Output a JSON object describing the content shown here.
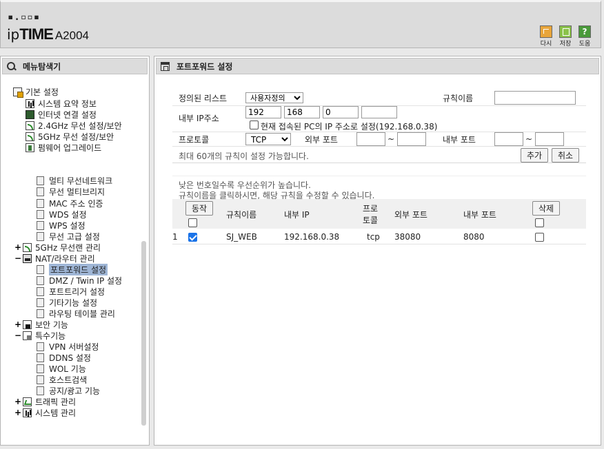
{
  "header": {
    "logo_dots": "▪.▫▫▪",
    "logo_brand_prefix": "ip",
    "logo_brand_main": "TIME",
    "model": "A2004",
    "buttons": [
      {
        "label": "다시",
        "icon": "reload-icon"
      },
      {
        "label": "저장",
        "icon": "save-icon"
      },
      {
        "label": "도움",
        "icon": "help-icon",
        "glyph": "?"
      }
    ]
  },
  "sidebar": {
    "title": "메뉴탐색기",
    "items": [
      {
        "label": "기본 설정",
        "exp": "",
        "icon": "folder"
      },
      {
        "label": "시스템 요약 정보",
        "icon": "chart"
      },
      {
        "label": "인터넷 연결 설정",
        "icon": "pc"
      },
      {
        "label": "2.4GHz 무선 설정/보안",
        "icon": "wifi"
      },
      {
        "label": "5GHz 무선 설정/보안",
        "icon": "wifi"
      },
      {
        "label": "펌웨어 업그레이드",
        "icon": "firm"
      },
      {
        "label": "멀티 무선네트워크",
        "icon": "page"
      },
      {
        "label": "무선 멀티브리지",
        "icon": "page"
      },
      {
        "label": "MAC 주소 인증",
        "icon": "page"
      },
      {
        "label": "WDS 설정",
        "icon": "page"
      },
      {
        "label": "WPS 설정",
        "icon": "page"
      },
      {
        "label": "무선 고급 설정",
        "icon": "page"
      },
      {
        "label": "5GHz 무선랜 관리",
        "exp": "+",
        "icon": "wifi"
      },
      {
        "label": "NAT/라우터 관리",
        "exp": "−",
        "icon": "nat"
      },
      {
        "label": "포트포워드 설정",
        "icon": "page"
      },
      {
        "label": "DMZ / Twin IP 설정",
        "icon": "page"
      },
      {
        "label": "포트트리거 설정",
        "icon": "page"
      },
      {
        "label": "기타기능 설정",
        "icon": "page"
      },
      {
        "label": "라우팅 테이블 관리",
        "icon": "page"
      },
      {
        "label": "보안 기능",
        "exp": "+",
        "icon": "lock"
      },
      {
        "label": "특수기능",
        "exp": "−",
        "icon": "special"
      },
      {
        "label": "VPN 서버설정",
        "icon": "page"
      },
      {
        "label": "DDNS 설정",
        "icon": "page"
      },
      {
        "label": "WOL 기능",
        "icon": "page"
      },
      {
        "label": "호스트검색",
        "icon": "page"
      },
      {
        "label": "공지/광고 기능",
        "icon": "page"
      },
      {
        "label": "트래픽 관리",
        "exp": "+",
        "icon": "traffic"
      },
      {
        "label": "시스템 관리",
        "exp": "+",
        "icon": "chart"
      }
    ]
  },
  "main": {
    "title": "포트포워드 설정",
    "form": {
      "predefined_label": "정의된 리스트",
      "predefined_value": "사용자정의",
      "rule_name_label": "규칙이름",
      "rule_name_value": "",
      "internal_ip_label": "내부 IP주소",
      "ip_octets": [
        "192",
        "168",
        "0",
        ""
      ],
      "current_pc_label": "현재 접속된 PC의 IP 주소로 설정(192.168.0.38)",
      "protocol_label": "프로토콜",
      "protocol_value": "TCP",
      "ext_port_label": "외부 포트",
      "int_port_label": "내부 포트",
      "tilde": "~",
      "max_rules_text": "최대 60개의 규칙이 설정 가능합니다.",
      "add_button": "추가",
      "cancel_button": "취소"
    },
    "notes": [
      "낮은 번호일수록 우선순위가 높습니다.",
      "규칙이름을 클릭하시면, 해당 규칙을 수정할 수 있습니다."
    ],
    "table": {
      "action_button": "동작",
      "delete_button": "삭제",
      "headers": {
        "name": "규칙이름",
        "ip": "내부 IP",
        "proto_line1": "프로",
        "proto_line2": "토콜",
        "ext": "외부 포트",
        "int": "내부 포트"
      },
      "rows": [
        {
          "no": "1",
          "enabled": true,
          "name": "SJ_WEB",
          "ip": "192.168.0.38",
          "proto": "tcp",
          "ext": "38080",
          "int": "8080",
          "delete": false
        }
      ]
    }
  }
}
